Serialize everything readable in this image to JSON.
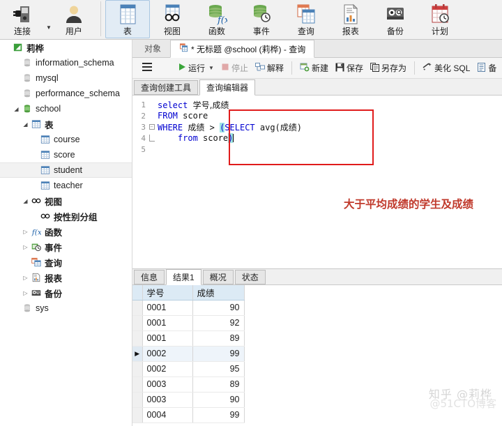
{
  "ribbon": {
    "groups": [
      {
        "buttons": [
          {
            "label": "连接",
            "icon": "connection-icon",
            "selected": false,
            "caret": true
          },
          {
            "label": "用户",
            "icon": "user-icon",
            "selected": false,
            "caret": false
          }
        ]
      },
      {
        "buttons": [
          {
            "label": "表",
            "icon": "table-icon",
            "selected": true,
            "caret": false
          },
          {
            "label": "视图",
            "icon": "view-icon",
            "selected": false,
            "caret": false
          },
          {
            "label": "函数",
            "icon": "function-icon",
            "selected": false,
            "caret": false
          },
          {
            "label": "事件",
            "icon": "event-icon",
            "selected": false,
            "caret": false
          },
          {
            "label": "查询",
            "icon": "query-icon",
            "selected": false,
            "caret": false
          },
          {
            "label": "报表",
            "icon": "report-icon",
            "selected": false,
            "caret": false
          },
          {
            "label": "备份",
            "icon": "backup-icon",
            "selected": false,
            "caret": false
          },
          {
            "label": "计划",
            "icon": "schedule-icon",
            "selected": false,
            "caret": false
          }
        ]
      }
    ]
  },
  "sidebar": {
    "items": [
      {
        "label": "莉桦",
        "icon": "connection-green-icon",
        "indent": 0,
        "twisty": "",
        "bold": true
      },
      {
        "label": "information_schema",
        "icon": "database-gray-icon",
        "indent": 1,
        "twisty": ""
      },
      {
        "label": "mysql",
        "icon": "database-gray-icon",
        "indent": 1,
        "twisty": ""
      },
      {
        "label": "performance_schema",
        "icon": "database-gray-icon",
        "indent": 1,
        "twisty": ""
      },
      {
        "label": "school",
        "icon": "database-green-icon",
        "indent": 1,
        "twisty": "open"
      },
      {
        "label": "表",
        "icon": "table-icon",
        "indent": 2,
        "twisty": "open",
        "bold": true
      },
      {
        "label": "course",
        "icon": "table-icon",
        "indent": 3,
        "twisty": ""
      },
      {
        "label": "score",
        "icon": "table-icon",
        "indent": 3,
        "twisty": ""
      },
      {
        "label": "student",
        "icon": "table-icon",
        "indent": 3,
        "twisty": "",
        "selected": true
      },
      {
        "label": "teacher",
        "icon": "table-icon",
        "indent": 3,
        "twisty": ""
      },
      {
        "label": "视图",
        "icon": "view-glasses-icon",
        "indent": 2,
        "twisty": "open",
        "bold": true
      },
      {
        "label": "按性别分组",
        "icon": "view-glasses-icon",
        "indent": 3,
        "twisty": "",
        "bold": true
      },
      {
        "label": "函数",
        "icon": "function-icon",
        "indent": 2,
        "twisty": "closed",
        "bold": true
      },
      {
        "label": "事件",
        "icon": "event-icon",
        "indent": 2,
        "twisty": "closed",
        "bold": true
      },
      {
        "label": "查询",
        "icon": "query-icon",
        "indent": 2,
        "twisty": "",
        "bold": true
      },
      {
        "label": "报表",
        "icon": "report-icon",
        "indent": 2,
        "twisty": "closed",
        "bold": true
      },
      {
        "label": "备份",
        "icon": "backup-icon",
        "indent": 2,
        "twisty": "closed",
        "bold": true
      },
      {
        "label": "sys",
        "icon": "database-gray-icon",
        "indent": 1,
        "twisty": ""
      }
    ]
  },
  "doc_tabs": [
    {
      "label": "对象",
      "icon": "",
      "active": false
    },
    {
      "label": "* 无标题 @school (莉桦) - 查询",
      "icon": "query-icon",
      "active": true
    }
  ],
  "editor_toolbar": {
    "menu_icon": "hamburger-icon",
    "items": [
      {
        "label": "运行",
        "icon": "play-icon",
        "caret": true,
        "disabled": false
      },
      {
        "label": "停止",
        "icon": "stop-icon",
        "caret": false,
        "disabled": true
      },
      {
        "label": "解释",
        "icon": "explain-icon",
        "caret": false,
        "disabled": false
      },
      {
        "sep": true
      },
      {
        "label": "新建",
        "icon": "new-icon",
        "caret": false,
        "disabled": false
      },
      {
        "label": "保存",
        "icon": "save-icon",
        "caret": false,
        "disabled": false
      },
      {
        "label": "另存为",
        "icon": "save-as-icon",
        "caret": false,
        "disabled": false
      },
      {
        "sep": true
      },
      {
        "label": "美化 SQL",
        "icon": "beautify-icon",
        "caret": false,
        "disabled": false
      },
      {
        "label": "备",
        "icon": "note-icon",
        "caret": false,
        "disabled": false
      }
    ]
  },
  "sub_tabs": [
    {
      "label": "查询创建工具",
      "active": false
    },
    {
      "label": "查询编辑器",
      "active": true
    }
  ],
  "sql": {
    "lines": [
      {
        "num": "1",
        "fold": "",
        "tokens": [
          {
            "t": "select ",
            "c": "kw"
          },
          {
            "t": "学号,成绩",
            "c": "cjk"
          }
        ]
      },
      {
        "num": "2",
        "fold": "",
        "tokens": [
          {
            "t": "FROM ",
            "c": "kw"
          },
          {
            "t": "score",
            "c": "id"
          }
        ]
      },
      {
        "num": "3",
        "fold": "minus",
        "tokens": [
          {
            "t": "WHERE ",
            "c": "kw"
          },
          {
            "t": "成绩",
            "c": "cjk"
          },
          {
            "t": " > ",
            "c": "id"
          },
          {
            "t": "(",
            "c": "hl"
          },
          {
            "t": "SELECT ",
            "c": "kw"
          },
          {
            "t": "avg(",
            "c": "id"
          },
          {
            "t": "成绩",
            "c": "cjk"
          },
          {
            "t": ")",
            "c": "id"
          }
        ]
      },
      {
        "num": "4",
        "fold": "end",
        "tokens": [
          {
            "t": "    ",
            "c": "id"
          },
          {
            "t": "from ",
            "c": "kw"
          },
          {
            "t": "score",
            "c": "id"
          },
          {
            "t": ")",
            "c": "hl"
          }
        ]
      },
      {
        "num": "5",
        "fold": "",
        "tokens": []
      }
    ]
  },
  "annotation": {
    "text": "大于平均成绩的学生及成绩",
    "color": "#c0392b"
  },
  "result_tabs": [
    {
      "label": "信息",
      "active": false
    },
    {
      "label": "结果1",
      "active": true
    },
    {
      "label": "概况",
      "active": false
    },
    {
      "label": "状态",
      "active": false
    }
  ],
  "result_grid": {
    "columns": [
      "学号",
      "成绩"
    ],
    "rows": [
      {
        "cells": [
          "0001",
          "90"
        ],
        "current": false
      },
      {
        "cells": [
          "0001",
          "92"
        ],
        "current": false
      },
      {
        "cells": [
          "0001",
          "89"
        ],
        "current": false
      },
      {
        "cells": [
          "0002",
          "99"
        ],
        "current": true
      },
      {
        "cells": [
          "0002",
          "95"
        ],
        "current": false
      },
      {
        "cells": [
          "0003",
          "89"
        ],
        "current": false
      },
      {
        "cells": [
          "0003",
          "90"
        ],
        "current": false
      },
      {
        "cells": [
          "0004",
          "99"
        ],
        "current": false
      }
    ]
  },
  "watermarks": {
    "primary": "知乎 @莉桦",
    "secondary": "@51CTO博客"
  }
}
